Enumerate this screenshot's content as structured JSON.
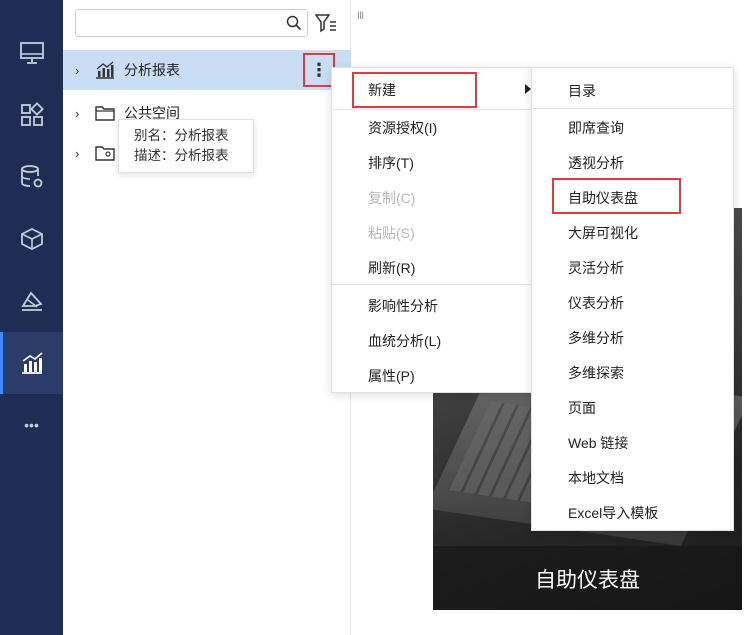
{
  "sidebar": {
    "items": [
      {
        "icon": "monitor-icon"
      },
      {
        "icon": "grid-icon"
      },
      {
        "icon": "database-settings-icon"
      },
      {
        "icon": "cube-icon"
      },
      {
        "icon": "layers-icon"
      },
      {
        "icon": "bar-chart-icon",
        "active": true
      },
      {
        "icon": "more-dots-icon",
        "label": "•••"
      }
    ],
    "background": "#1f2d54",
    "active_color": "#3d8bff"
  },
  "tree": {
    "search_placeholder": "",
    "items": [
      {
        "label": "分析报表",
        "icon": "report-icon",
        "selected": true
      },
      {
        "label": "公共空间",
        "icon": "folder-icon"
      },
      {
        "label": "",
        "icon": "user-folder-icon"
      }
    ],
    "more_button": "⋮",
    "tooltip": {
      "alias": "别名：分析报表",
      "description": "描述：分析报表"
    }
  },
  "splitter_label": "III",
  "context_menu": {
    "items": [
      {
        "label": "新建",
        "has_submenu": true,
        "highlighted": true
      },
      {
        "label": "资源授权(I)"
      },
      {
        "label": "排序(T)"
      },
      {
        "label": "复制(C)",
        "disabled": true
      },
      {
        "label": "粘贴(S)",
        "disabled": true
      },
      {
        "label": "刷新(R)"
      },
      {
        "label": "影响性分析"
      },
      {
        "label": "血统分析(L)"
      },
      {
        "label": "属性(P)"
      }
    ]
  },
  "submenu": {
    "items": [
      {
        "label": "目录"
      },
      {
        "label": "即席查询"
      },
      {
        "label": "透视分析"
      },
      {
        "label": "自助仪表盘",
        "highlighted": true
      },
      {
        "label": "大屏可视化"
      },
      {
        "label": "灵活分析"
      },
      {
        "label": "仪表分析"
      },
      {
        "label": "多维分析"
      },
      {
        "label": "多维探索"
      },
      {
        "label": "页面"
      },
      {
        "label": "Web 链接"
      },
      {
        "label": "本地文档"
      },
      {
        "label": "Excel导入模板"
      }
    ]
  },
  "preview": {
    "caption": "自助仪表盘"
  },
  "colors": {
    "selection": "#c9def5",
    "highlight_border": "#e23b3b"
  }
}
